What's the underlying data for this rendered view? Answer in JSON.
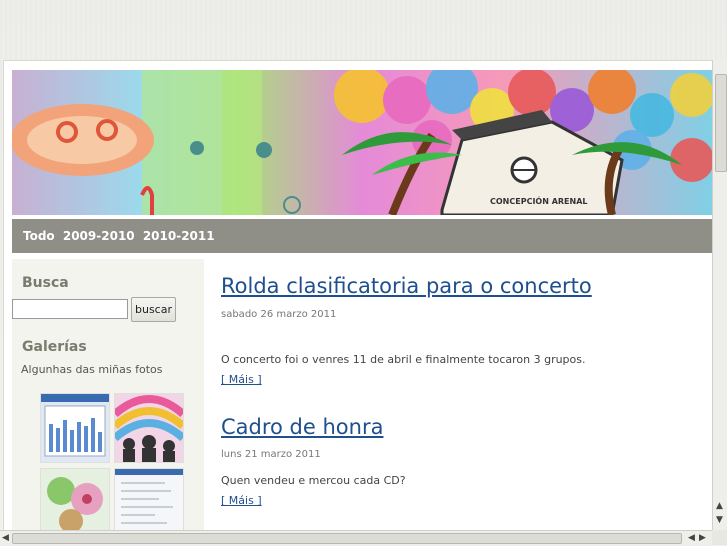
{
  "nav": {
    "items": [
      "Todo",
      "2009-2010",
      "2010-2011"
    ]
  },
  "sidebar": {
    "search_title": "Busca",
    "search_value": "",
    "search_button": "buscar",
    "gallery_title": "Galerías",
    "gallery_subtitle": "Algunhas das miñas fotos"
  },
  "posts": [
    {
      "title": "Rolda clasificatoria para o concerto",
      "date": "sabado 26 marzo 2011",
      "body": "O concerto foi o venres 11 de abril e finalmente tocaron 3 grupos.",
      "more": "Máis"
    },
    {
      "title": "Cadro de honra",
      "date": "luns 21 marzo 2011",
      "body": "Quen vendeu e mercou cada CD?",
      "more": "Máis"
    }
  ],
  "icons": {
    "banner": "school-drawing-image",
    "scroll_up": "arrow-up-icon",
    "scroll_down": "arrow-down-icon",
    "scroll_left": "arrow-left-icon",
    "scroll_right": "arrow-right-icon"
  },
  "colors": {
    "nav_bg": "#8f8f87",
    "link": "#1f4f8f",
    "sidebar_bg": "#f4f4ee"
  }
}
